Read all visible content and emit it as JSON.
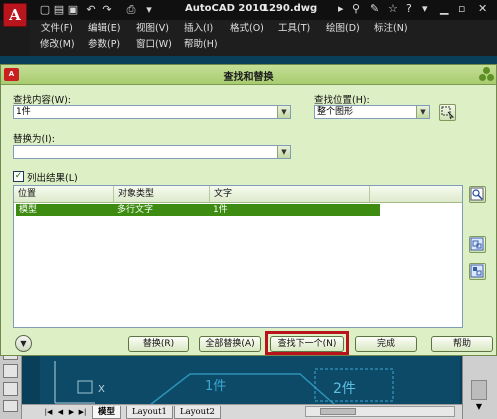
{
  "app": {
    "title": "AutoCAD 2010",
    "file": "1290.dwg",
    "logo_letter": "A"
  },
  "menubar": {
    "row1": [
      "文件(F)",
      "编辑(E)",
      "视图(V)",
      "插入(I)",
      "格式(O)",
      "工具(T)",
      "绘图(D)",
      "标注(N)"
    ],
    "row2": [
      "修改(M)",
      "参数(P)",
      "窗口(W)",
      "帮助(H)"
    ]
  },
  "dialog": {
    "title": "查找和替换",
    "logo_text": "A",
    "find_what_label": "查找内容(W):",
    "find_what_value": "1件",
    "find_where_label": "查找位置(H):",
    "find_where_value": "整个图形",
    "replace_with_label": "替换为(I):",
    "replace_with_value": "",
    "list_results_label": "列出结果(L)",
    "list_results_checked": true,
    "columns": [
      "位置",
      "对象类型",
      "文字"
    ],
    "rows": [
      {
        "location": "模型",
        "object_type": "多行文字",
        "text": "1件"
      }
    ],
    "buttons": {
      "replace": "替换(R)",
      "replace_all": "全部替换(A)",
      "find_next": "查找下一个(N)",
      "done": "完成",
      "help": "帮助"
    },
    "highlight_color": "#b9121d",
    "selected_row_color": "#3d8b10"
  },
  "canvas": {
    "text_1": "1件",
    "text_2": "2件",
    "axis_x": "X",
    "layout_tabs": [
      "模型",
      "Layout1",
      "Layout2"
    ]
  }
}
